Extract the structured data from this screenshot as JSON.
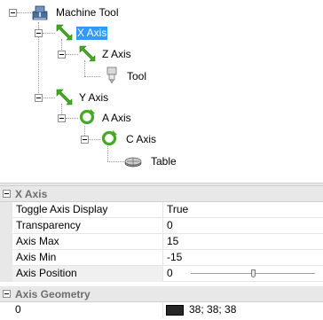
{
  "tree": {
    "root": {
      "label": "Machine Tool",
      "icon": "machine-tool-icon"
    },
    "nodes": [
      {
        "label": "X Axis",
        "icon": "linear-axis-icon",
        "selected": true
      },
      {
        "label": "Z Axis",
        "icon": "linear-axis-icon"
      },
      {
        "label": "Tool",
        "icon": "tool-icon"
      },
      {
        "label": "Y Axis",
        "icon": "linear-axis-icon"
      },
      {
        "label": "A Axis",
        "icon": "rotary-axis-icon"
      },
      {
        "label": "C Axis",
        "icon": "rotary-axis-icon"
      },
      {
        "label": "Table",
        "icon": "table-icon"
      }
    ]
  },
  "properties": {
    "category1": "X Axis",
    "rows": [
      {
        "name": "Toggle Axis Display",
        "value": "True"
      },
      {
        "name": "Transparency",
        "value": "0"
      },
      {
        "name": "Axis Max",
        "value": "15"
      },
      {
        "name": "Axis Min",
        "value": "-15"
      },
      {
        "name": "Axis Position",
        "value": "0",
        "slider_fraction": 0.5
      }
    ],
    "category2": "Axis Geometry",
    "geometry": {
      "left": "0",
      "color_hex": "#262626",
      "color_text": "38; 38; 38"
    }
  },
  "colors": {
    "selection": "#3399ff",
    "axis_arrow": "#44aa22",
    "category_bg": "#e8e8e8"
  }
}
